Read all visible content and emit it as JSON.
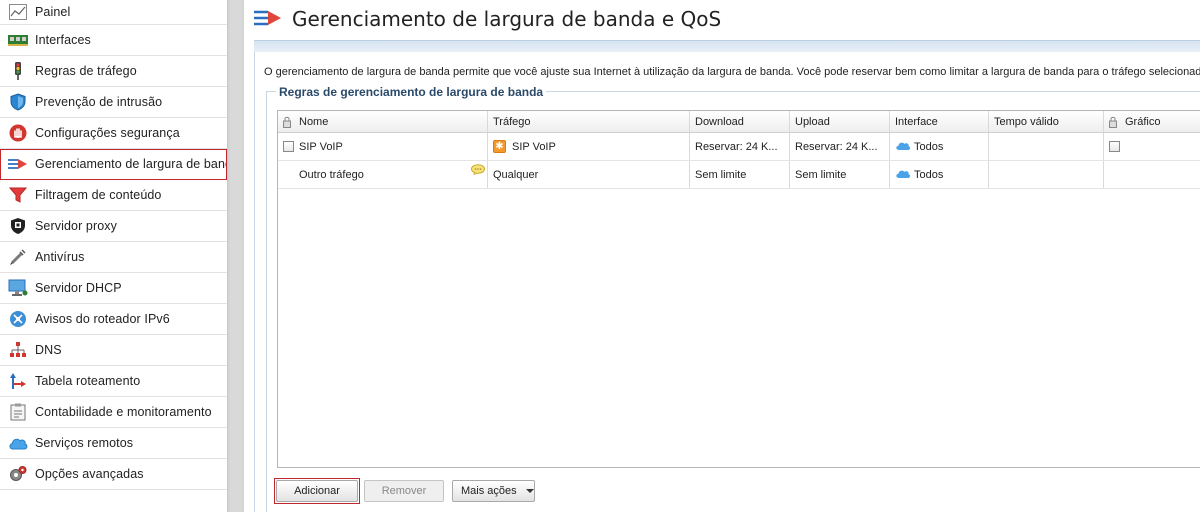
{
  "sidebar": {
    "items": [
      {
        "label": "Painel",
        "icon": "chart-icon"
      },
      {
        "label": "Interfaces",
        "icon": "network-card-icon"
      },
      {
        "label": "Regras de tráfego",
        "icon": "traffic-light-icon"
      },
      {
        "label": "Prevenção de intrusão",
        "icon": "shield-icon"
      },
      {
        "label": "Configurações segurança",
        "icon": "hand-stop-icon"
      },
      {
        "label": "Gerenciamento de largura de banda",
        "icon": "bandwidth-arrow-icon"
      },
      {
        "label": "Filtragem de conteúdo",
        "icon": "funnel-icon"
      },
      {
        "label": "Servidor proxy",
        "icon": "proxy-shield-icon"
      },
      {
        "label": "Antivírus",
        "icon": "syringe-icon"
      },
      {
        "label": "Servidor DHCP",
        "icon": "monitor-icon"
      },
      {
        "label": "Avisos do roteador IPv6",
        "icon": "ipv6-network-icon"
      },
      {
        "label": "DNS",
        "icon": "dns-tree-icon"
      },
      {
        "label": "Tabela roteamento",
        "icon": "routing-arrows-icon"
      },
      {
        "label": "Contabilidade e monitoramento",
        "icon": "clipboard-icon"
      },
      {
        "label": "Serviços remotos",
        "icon": "cloud-icon"
      },
      {
        "label": "Opções avançadas",
        "icon": "gears-icon"
      }
    ],
    "active_index": 5
  },
  "header": {
    "title": "Gerenciamento de largura de banda e QoS"
  },
  "main": {
    "description": "O gerenciamento de largura de banda permite que você ajuste sua Internet à utilização da largura de banda. Você pode reservar bem como limitar a largura de banda para o tráfego selecionado.",
    "section_title": "Regras de gerenciamento de largura de banda",
    "table": {
      "columns": [
        "Nome",
        "Tráfego",
        "Download",
        "Upload",
        "Interface",
        "Tempo válido",
        "Gráfico"
      ],
      "rows": [
        {
          "name": "SIP VoIP",
          "traffic": "SIP VoIP",
          "download": "Reservar: 24 K...",
          "upload": "Reservar: 24 K...",
          "interface": "Todos",
          "valid_time": "",
          "graph": ""
        },
        {
          "name": "Outro tráfego",
          "traffic": "Qualquer",
          "download": "Sem limite",
          "upload": "Sem limite",
          "interface": "Todos",
          "valid_time": "",
          "graph": ""
        }
      ]
    },
    "buttons": {
      "add": "Adicionar",
      "remove": "Remover",
      "more": "Mais ações"
    }
  },
  "colors": {
    "accent_red": "#c0282d",
    "band_blue": "#d6e4f1",
    "legend_text": "#2a4a6a"
  }
}
